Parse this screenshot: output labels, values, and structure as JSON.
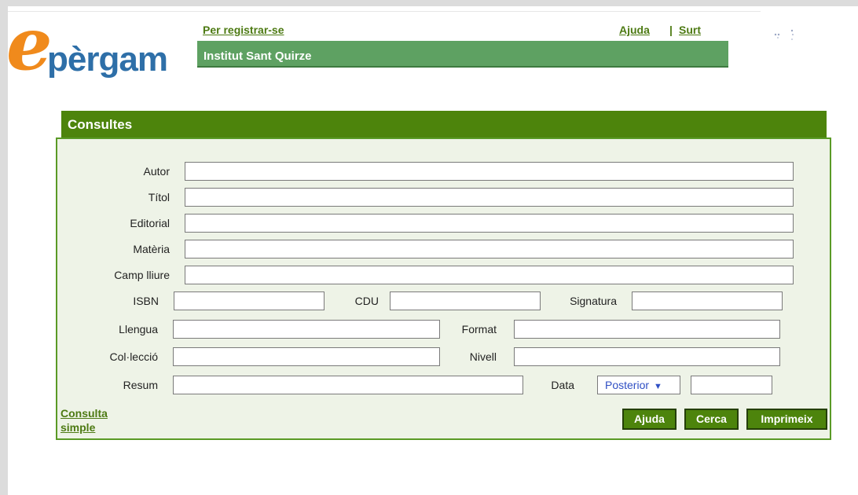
{
  "header": {
    "logo_e": "e",
    "logo_rest": "pèrgam",
    "register_link": "Per registrar-se",
    "help_link": "Ajuda",
    "separator": "|",
    "exit_link": "Surt",
    "library_name": "Institut Sant Quirze"
  },
  "panel": {
    "title": "Consultes",
    "fields": {
      "autor": "Autor",
      "titol": "Títol",
      "editorial": "Editorial",
      "materia": "Matèria",
      "camp_lliure": "Camp lliure",
      "isbn": "ISBN",
      "cdu": "CDU",
      "signatura": "Signatura",
      "llengua": "Llengua",
      "format": "Format",
      "colleccio": "Col·lecció",
      "nivell": "Nivell",
      "resum": "Resum",
      "data": "Data"
    },
    "date_select": {
      "selected": "Posterior",
      "arrow": "▼"
    },
    "simple_link": "Consulta simple",
    "buttons": {
      "help": "Ajuda",
      "search": "Cerca",
      "print": "Imprimeix"
    }
  },
  "colors": {
    "panel_header": "#4d840c",
    "library_bar": "#5ea162",
    "panel_bg": "#eef3e7",
    "logo_orange": "#f08a1c",
    "logo_blue": "#2e6fa8"
  }
}
